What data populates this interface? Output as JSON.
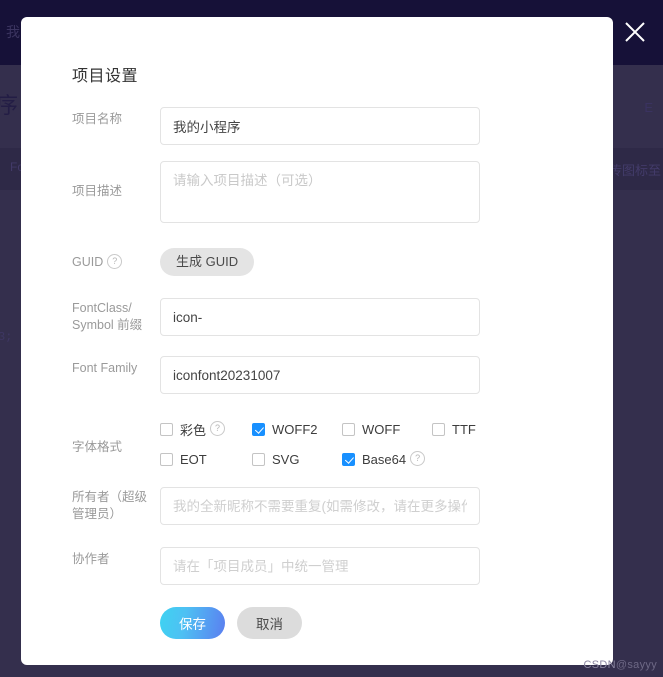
{
  "backdrop": {
    "header_text": "我的",
    "row_title": "序",
    "label_left": "Fo",
    "label_right": "传图标至",
    "right_fragment": "E",
    "code_fragment": "3;",
    "colors": {
      "header_bg": "#161138",
      "body_bg": "#342f4d",
      "strip_bg": "#2e2947"
    }
  },
  "close_button": {
    "icon": "close-icon",
    "color": "#ffffff"
  },
  "modal": {
    "title": "项目设置",
    "fields": {
      "project_name": {
        "label": "项目名称",
        "value": "我的小程序",
        "placeholder": ""
      },
      "project_desc": {
        "label": "项目描述",
        "value": "",
        "placeholder": "请输入项目描述（可选）"
      },
      "guid": {
        "label": "GUID",
        "help_icon": "question-circle-icon",
        "button_label": "生成 GUID"
      },
      "fontclass_prefix": {
        "label_line1": "FontClass/",
        "label_line2": "Symbol 前缀",
        "value": "icon-",
        "placeholder": ""
      },
      "font_family": {
        "label": "Font Family",
        "value": "iconfont20231007",
        "placeholder": ""
      },
      "font_format": {
        "label": "字体格式",
        "rows": [
          [
            {
              "label": "彩色",
              "checked": false,
              "help_icon": "question-circle-icon"
            },
            {
              "label": "WOFF2",
              "checked": true,
              "help_icon": null
            },
            {
              "label": "WOFF",
              "checked": false,
              "help_icon": null
            },
            {
              "label": "TTF",
              "checked": false,
              "help_icon": null
            }
          ],
          [
            {
              "label": "EOT",
              "checked": false,
              "help_icon": null
            },
            {
              "label": "SVG",
              "checked": false,
              "help_icon": null
            },
            {
              "label": "Base64",
              "checked": true,
              "help_icon": "question-circle-icon"
            }
          ]
        ]
      },
      "owner": {
        "label_line1": "所有者（超级",
        "label_line2": "管理员）",
        "value": "",
        "placeholder": "我的全新昵称不需要重复(如需修改，请在更多操作里转让"
      },
      "collaborator": {
        "label": "协作者",
        "value": "",
        "placeholder": "请在「项目成员」中统一管理"
      }
    },
    "actions": {
      "save_label": "保存",
      "cancel_label": "取消"
    },
    "accent_colors": {
      "checkbox_checked": "#1890ff",
      "save_gradient_start": "#3ed3f2",
      "save_gradient_end": "#5b7ef0",
      "cancel_bg": "#dcdcdc",
      "guid_button_bg": "#e4e4e4"
    }
  },
  "watermark": {
    "brand": "CSDN",
    "user": "@sayyy"
  }
}
